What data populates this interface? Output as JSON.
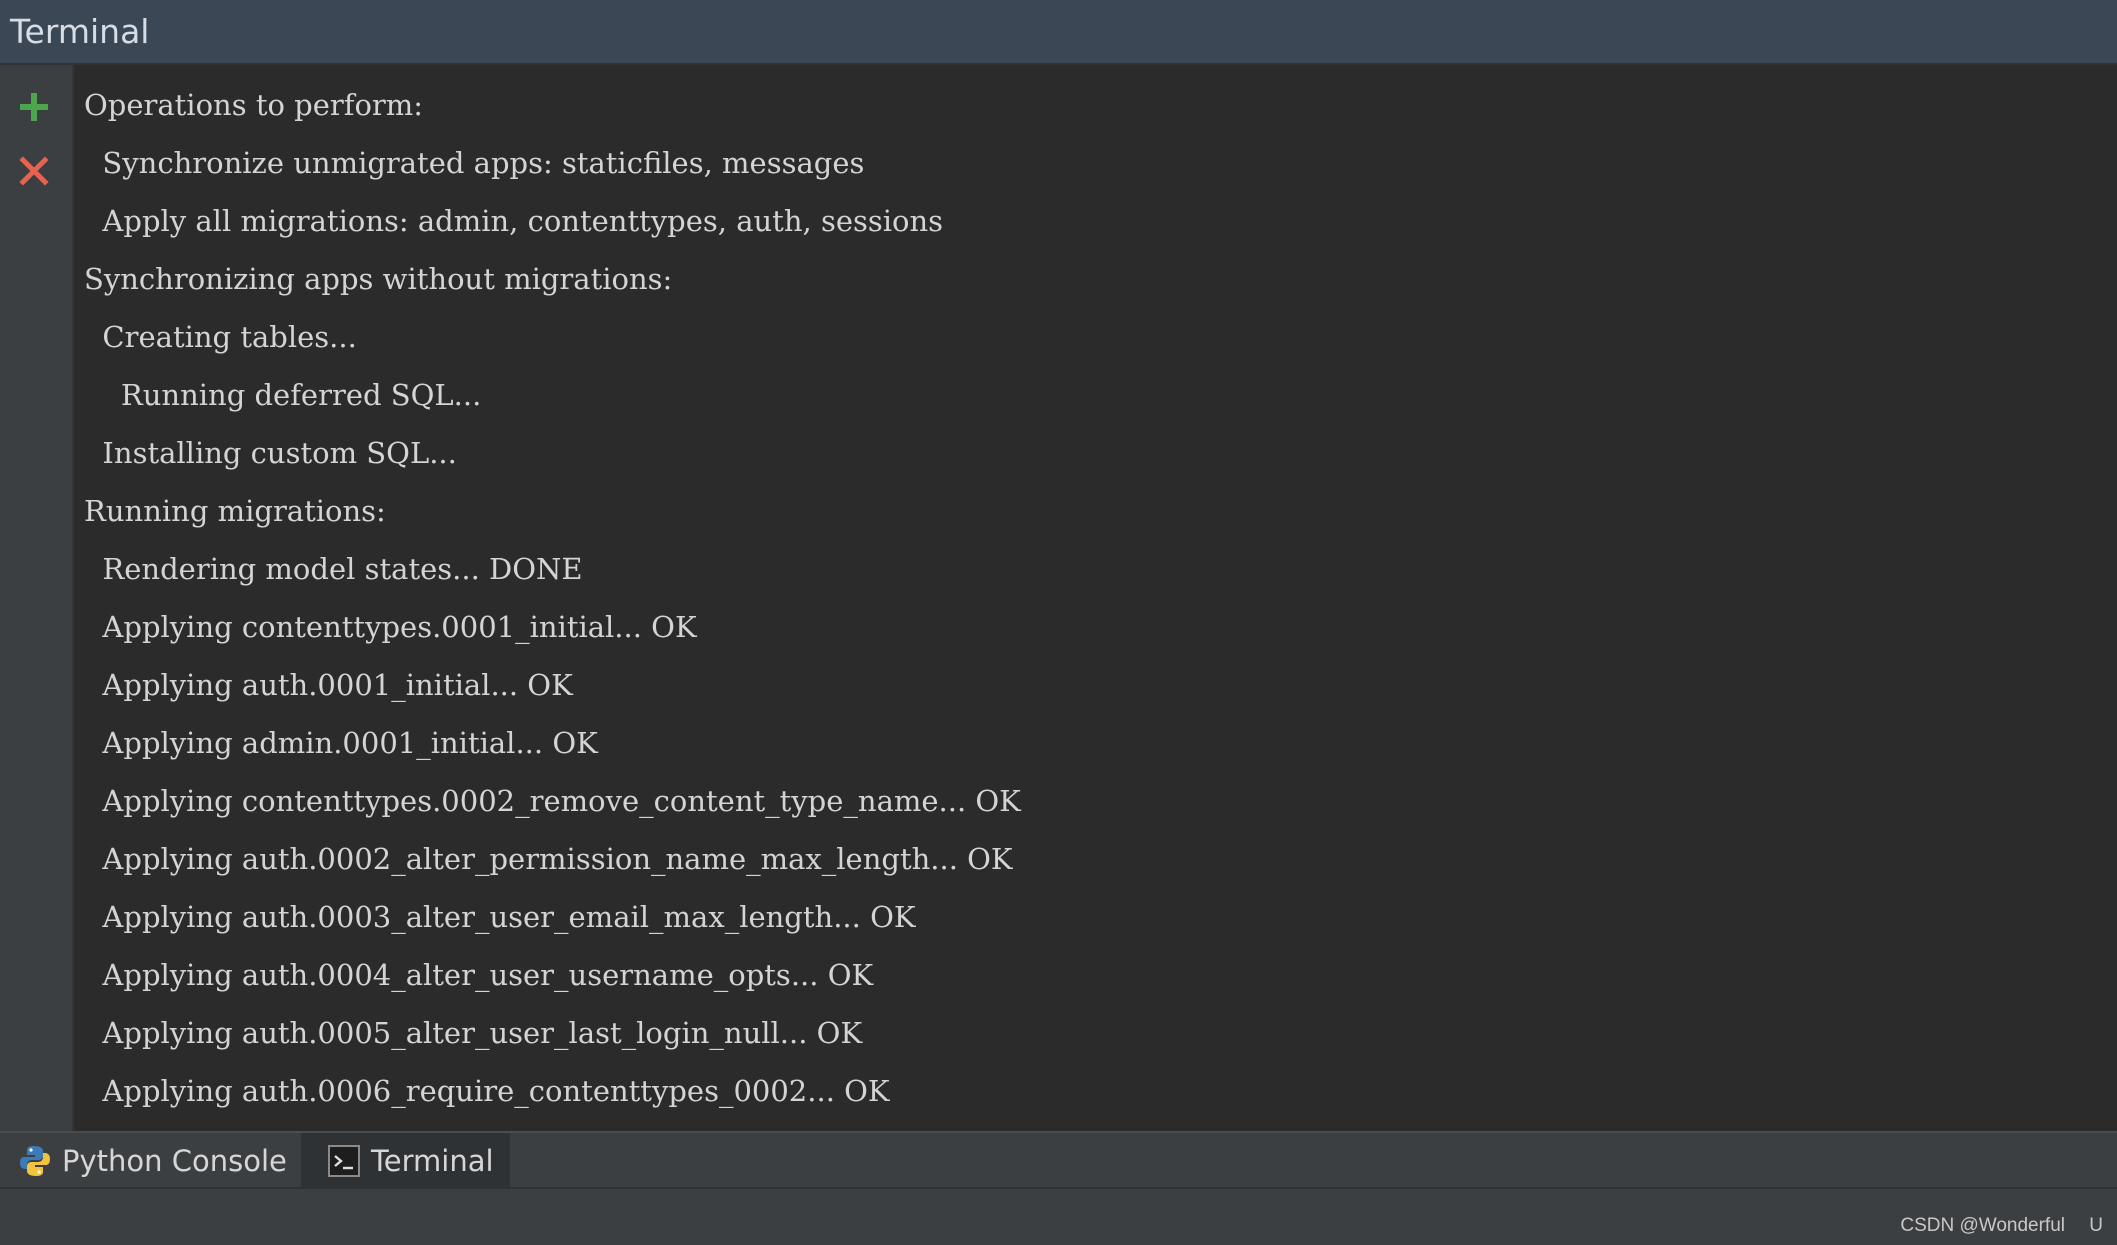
{
  "window": {
    "title": "Terminal"
  },
  "gutter": {
    "add_icon": "plus-icon",
    "close_icon": "close-icon",
    "add_color": "#4ca64c",
    "close_color": "#e8624f"
  },
  "terminal": {
    "lines": [
      "Operations to perform:",
      "  Synchronize unmigrated apps: staticfiles, messages",
      "  Apply all migrations: admin, contenttypes, auth, sessions",
      "Synchronizing apps without migrations:",
      "  Creating tables...",
      "    Running deferred SQL...",
      "  Installing custom SQL...",
      "Running migrations:",
      "  Rendering model states... DONE",
      "  Applying contenttypes.0001_initial... OK",
      "  Applying auth.0001_initial... OK",
      "  Applying admin.0001_initial... OK",
      "  Applying contenttypes.0002_remove_content_type_name... OK",
      "  Applying auth.0002_alter_permission_name_max_length... OK",
      "  Applying auth.0003_alter_user_email_max_length... OK",
      "  Applying auth.0004_alter_user_username_opts... OK",
      "  Applying auth.0005_alter_user_last_login_null... OK",
      "  Applying auth.0006_require_contenttypes_0002... OK"
    ]
  },
  "tool_tabs": {
    "python_console": {
      "label": "Python Console",
      "icon": "python-icon"
    },
    "terminal": {
      "label": "Terminal",
      "icon": "terminal-icon",
      "selected": true
    }
  },
  "status_bar": {
    "credit": "CSDN @Wonderful",
    "indicator": "U"
  }
}
